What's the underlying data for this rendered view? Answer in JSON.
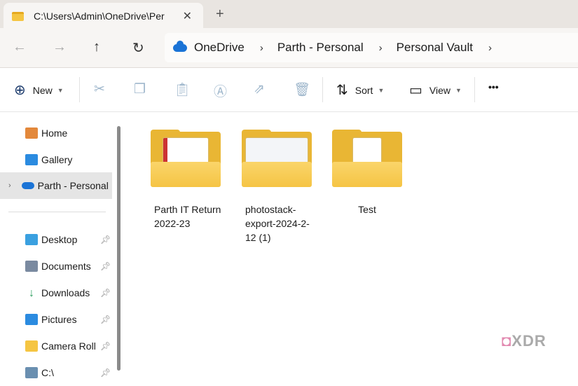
{
  "tab": {
    "title": "C:\\Users\\Admin\\OneDrive\\Per",
    "close": "✕",
    "new_tab": "+"
  },
  "nav": {
    "back": "←",
    "forward": "→",
    "up": "↑",
    "refresh": "↻"
  },
  "breadcrumb": [
    "OneDrive",
    "Parth - Personal",
    "Personal Vault"
  ],
  "breadcrumb_sep": "›",
  "toolbar": {
    "new": "New",
    "sort": "Sort",
    "view": "View",
    "more": "•••"
  },
  "sidebar": {
    "items": [
      {
        "label": "Home",
        "icon": "home-icon",
        "color": "#e3883b"
      },
      {
        "label": "Gallery",
        "icon": "gallery-icon",
        "color": "#2b8be0"
      },
      {
        "label": "Parth - Personal",
        "icon": "onedrive-icon",
        "color": "#1a73d6",
        "selected": true
      },
      {
        "label": "Desktop",
        "icon": "desktop-icon",
        "color": "#3aa0e0",
        "pinned": true
      },
      {
        "label": "Documents",
        "icon": "documents-icon",
        "color": "#7a8aa0",
        "pinned": true
      },
      {
        "label": "Downloads",
        "icon": "downloads-icon",
        "color": "#2a9d5c",
        "pinned": true
      },
      {
        "label": "Pictures",
        "icon": "pictures-icon",
        "color": "#2b8be0",
        "pinned": true
      },
      {
        "label": "Camera Roll",
        "icon": "folder-icon",
        "color": "#f5c542",
        "pinned": true
      },
      {
        "label": "C:\\",
        "icon": "drive-icon",
        "color": "#6a8fb0",
        "pinned": true
      }
    ]
  },
  "folders": [
    {
      "name": "Parth IT Return 2022-23"
    },
    {
      "name": "photostack-export-2024-2-12 (1)"
    },
    {
      "name": "Test"
    }
  ],
  "watermark": "XDR"
}
